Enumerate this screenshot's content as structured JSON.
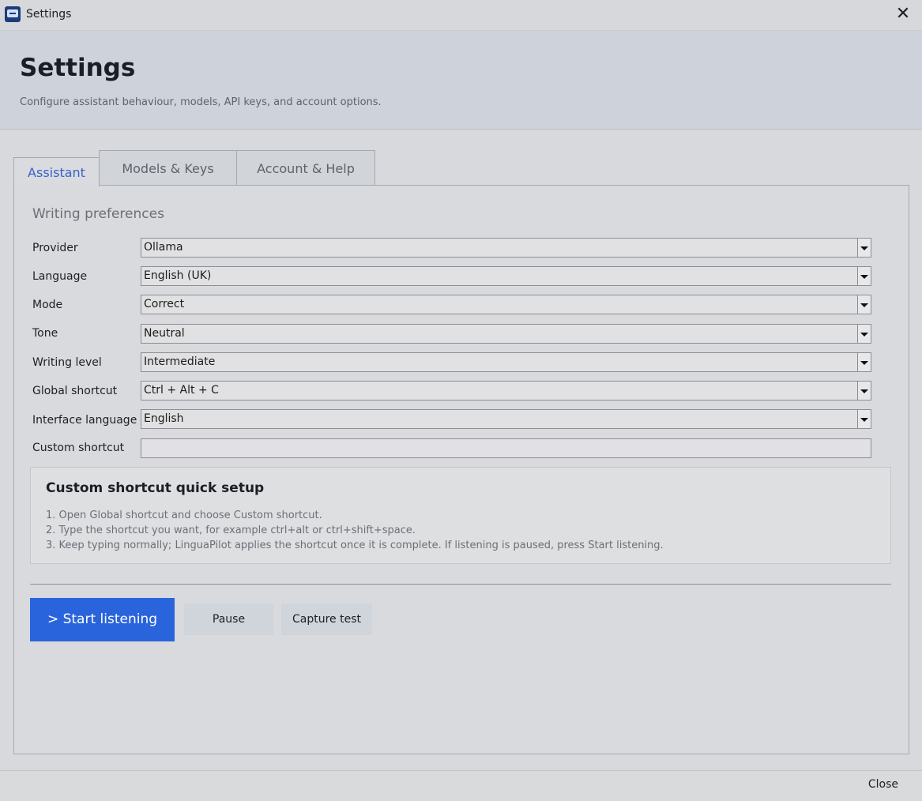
{
  "window": {
    "title": "Settings",
    "close_symbol": "✕",
    "icon": "app-window-icon"
  },
  "header": {
    "title": "Settings",
    "subtitle": "Configure assistant behaviour, models, API keys, and account options."
  },
  "tabs": [
    {
      "label": "Assistant",
      "active": true
    },
    {
      "label": "Models & Keys",
      "active": false
    },
    {
      "label": "Account & Help",
      "active": false
    }
  ],
  "section": {
    "title": "Writing preferences"
  },
  "fields": [
    {
      "label": "Provider",
      "value": "Ollama"
    },
    {
      "label": "Language",
      "value": "English (UK)"
    },
    {
      "label": "Mode",
      "value": "Correct"
    },
    {
      "label": "Tone",
      "value": "Neutral"
    },
    {
      "label": "Writing level",
      "value": "Intermediate"
    },
    {
      "label": "Global shortcut",
      "value": "Ctrl + Alt + C"
    },
    {
      "label": "Interface language",
      "value": "English"
    }
  ],
  "custom_shortcut": {
    "label": "Custom shortcut",
    "value": ""
  },
  "quick_setup": {
    "title": "Custom shortcut quick setup",
    "lines": [
      "1. Open Global shortcut and choose Custom shortcut.",
      "2. Type the shortcut you want, for example ctrl+alt or ctrl+shift+space.",
      "3. Keep typing normally; LinguaPilot applies the shortcut once it is complete. If listening is paused, press Start listening."
    ]
  },
  "actions": {
    "start": "> Start listening",
    "pause": "Pause",
    "capture": "Capture test"
  },
  "footer": {
    "close": "Close"
  },
  "colors": {
    "accent": "#2a64dc",
    "active_tab_text": "#3a62c9",
    "header_bg": "#cdd2db"
  }
}
